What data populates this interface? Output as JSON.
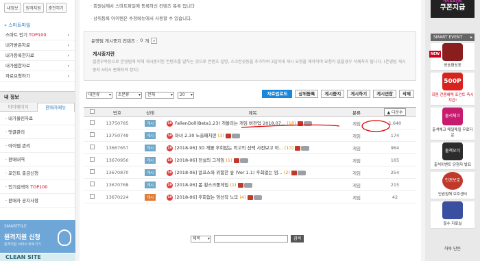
{
  "left": {
    "top_buttons": [
      "내정보",
      "원격지원",
      "충전하기"
    ],
    "smartfile_title": "스마트파일",
    "smartfile_items": [
      {
        "label": "스마트 인기 ",
        "highlight": "TOP100"
      },
      {
        "label": "내가받은자료",
        "highlight": ""
      },
      {
        "label": "내가등록한자료",
        "highlight": ""
      },
      {
        "label": "내가찜한자료",
        "highlight": ""
      },
      {
        "label": "자료요청하기",
        "highlight": ""
      }
    ],
    "info_title": "내 정보",
    "tabs": [
      "마이페이지",
      "판매자메뉴"
    ],
    "seller_menu": [
      {
        "label": "· 내가올린자료",
        "highlight": ""
      },
      {
        "label": "· 댓글관리",
        "highlight": ""
      },
      {
        "label": "· 아이템 관리",
        "highlight": ""
      },
      {
        "label": "· 판매내역",
        "highlight": ""
      },
      {
        "label": "· 포인트 출금신청",
        "highlight": ""
      },
      {
        "label": "· 인기검색어 ",
        "highlight": "TOP100"
      },
      {
        "label": "· 판매자 공지사항",
        "highlight": ""
      }
    ],
    "banner_small": "SMARTFILE",
    "banner_big": "원격지원 신청",
    "banner_sub": "원격지원 서비스 바로가기",
    "banner2": "CLEAN SITE"
  },
  "main": {
    "notices": [
      "회원님께서 스마트파일에 등록하신 컨텐츠 목록 입니다",
      "상위등록 아이템은 수정메뉴에서 사용할 수 있습니다."
    ],
    "ad_count_label": "운영팀 게시중지 컨텐츠 : ",
    "ad_count_value": "0",
    "ad_count_unit": "개",
    "ad_title": "게시중지란",
    "ad_text": "설명부족등으로 운영팀에 의해 게시중지된 컨텐츠를 말하는 것으로 컨텐츠 설명, 스크린샷등을 추가하여 3일이내 게시 요청을 해야하며 요청이 없을경우 삭제처리 됩니다. (운영팀 게시중지 5회시 판매자격 정지)",
    "filters": [
      "대분류",
      "소분류",
      "전체",
      "20"
    ],
    "actions": [
      "자료업로드",
      "상위등록",
      "게시중지",
      "게시하기",
      "게시연장",
      "삭제"
    ],
    "columns": {
      "no": "번호",
      "status": "상태",
      "title": "제목",
      "category": "분류",
      "downloads": "다운수"
    },
    "rows": [
      {
        "no": "13750785",
        "status": "게시",
        "age": "19",
        "title": "FallenDoll(Beta1.23) 개쓸리는 게임 버전업 2018.07...",
        "comments": "(18)",
        "category": "게임",
        "downloads": "1,640"
      },
      {
        "no": "13750749",
        "status": "게시",
        "age": "19",
        "title": "마녀 2.30 노출패치판",
        "comments": "(3)",
        "category": "게임",
        "downloads": "174"
      },
      {
        "no": "13667657",
        "status": "게시",
        "age": "19",
        "title": "[2018-06] 3D 게볼 후회없는 최고의 선택 사전보고 하...",
        "comments": "(13)",
        "category": "게임",
        "downloads": "964"
      },
      {
        "no": "13670950",
        "status": "게시",
        "age": "19",
        "title": "[2018-06] 전설의 그게임",
        "comments": "(1)",
        "category": "게임",
        "downloads": "165"
      },
      {
        "no": "13670870",
        "status": "게시",
        "age": "19",
        "title": "[2018-06] 알프스와 위험한 숲 (Ver 1.1) 후회없는 엄...",
        "comments": "(2)",
        "category": "게임",
        "downloads": "254"
      },
      {
        "no": "13670768",
        "status": "게시",
        "age": "19",
        "title": "[2018-06] 폼 횡스크롤게임",
        "comments": "(1)",
        "category": "게임",
        "downloads": "215"
      },
      {
        "no": "13670224",
        "status": "게시",
        "age": "19",
        "title": "[2018-06] 후회없는 엉선작 노모",
        "comments": "(4)",
        "category": "게임",
        "downloads": "42"
      }
    ],
    "search_select": "제목",
    "search_button": "검색"
  },
  "right": {
    "coupon_small": "캐시&포인트",
    "coupon": "쿠폰지급",
    "smart_event": "SMART EVENT",
    "new_tag": "NEW",
    "events": [
      {
        "label": "방송편성표",
        "sub": ""
      },
      {
        "label": "500P",
        "sub": "회원 전용혜택 포인트 즉시 지급!"
      },
      {
        "label": "출석체크",
        "sub": "출석체크 매일매일 무료다운"
      },
      {
        "label": "출첵오더",
        "sub": "출석이벤트 당첨자 발표"
      },
      {
        "label": "인권보호",
        "sub": "인권침해 보호센터"
      },
      {
        "label": "필수 자료실",
        "sub": ""
      }
    ],
    "bottom": "하루 단돈"
  },
  "colors": {
    "accent": "#1a86d9",
    "annotation": "#e00000"
  }
}
